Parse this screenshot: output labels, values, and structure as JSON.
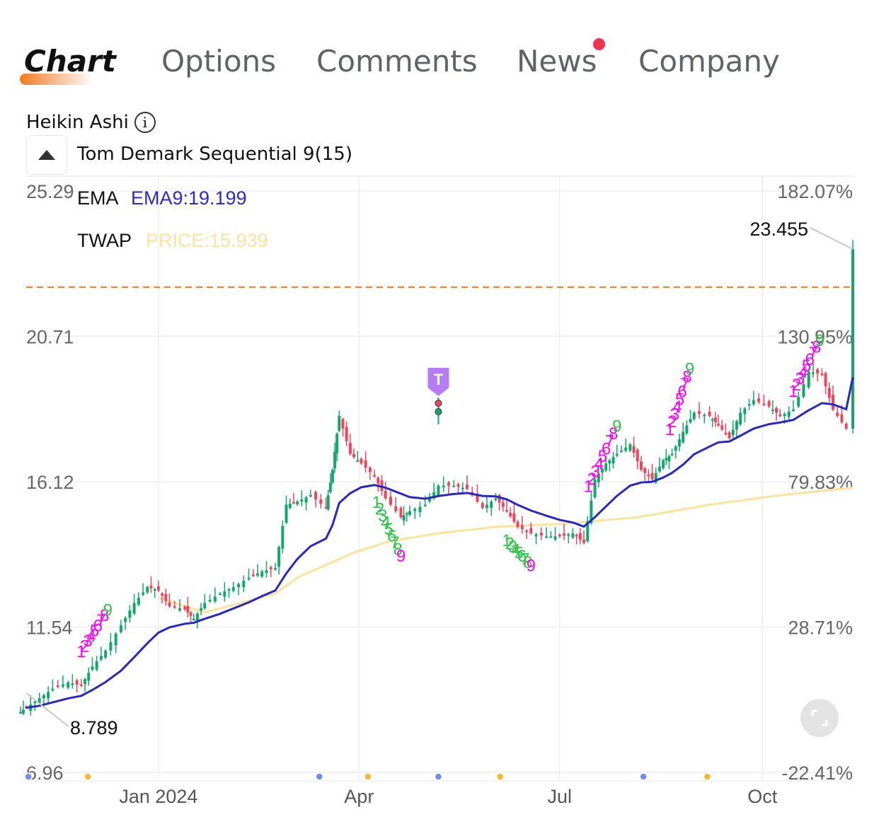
{
  "tabs": [
    {
      "label": "Chart",
      "active": true
    },
    {
      "label": "Options",
      "active": false
    },
    {
      "label": "Comments",
      "active": false
    },
    {
      "label": "News",
      "active": false,
      "badge_dot": true
    },
    {
      "label": "Company",
      "active": false
    }
  ],
  "chart_type_label": "Heikin Ashi",
  "info_icon": "info-icon",
  "indicator_title": "Tom Demark Sequential 9(15)",
  "collapse_icon": "triangle-up-icon",
  "legend": {
    "ema": {
      "name": "EMA",
      "value": "EMA9:19.199",
      "color": "#2a2ad0"
    },
    "twap": {
      "name": "TWAP",
      "value": "PRICE:15.939",
      "color": "#fde29a"
    }
  },
  "colors": {
    "up": "#12a86b",
    "down": "#f0445a",
    "ema": "#2727c4",
    "twap": "#fde29a",
    "dashed_line": "#f57c1f",
    "td_up": "#ff00ff",
    "td_down": "#2ec44a",
    "marker": "#b57cf5"
  },
  "chart_data": {
    "type": "candlestick",
    "style": "Heikin Ashi",
    "x_range": [
      "2023-11-02",
      "2024-11-11"
    ],
    "ylim": [
      6.96,
      25.29
    ],
    "grid": true,
    "y_ticks_left": [
      "25.29",
      "20.71",
      "16.12",
      "11.54",
      "6.96"
    ],
    "y_ticks_right": [
      "182.07%",
      "130.95%",
      "79.83%",
      "28.71%",
      "-22.41%"
    ],
    "x_ticks": [
      {
        "label": "Jan 2024",
        "date": "2024-01-01"
      },
      {
        "label": "Apr",
        "date": "2024-04-01"
      },
      {
        "label": "Jul",
        "date": "2024-07-01"
      },
      {
        "label": "Oct",
        "date": "2024-10-01"
      }
    ],
    "high_label": {
      "text": "23.455",
      "date": "2024-11-11",
      "price": 23.455
    },
    "low_label": {
      "text": "8.789",
      "date": "2023-11-02",
      "price": 8.789
    },
    "dashed_price_line": 22.26,
    "closes": [
      [
        "2023-11-02",
        9.0
      ],
      [
        "2023-11-08",
        9.3
      ],
      [
        "2023-11-14",
        9.6
      ],
      [
        "2023-11-21",
        9.8
      ],
      [
        "2023-11-27",
        9.7
      ],
      [
        "2023-12-02",
        10.3
      ],
      [
        "2023-12-08",
        10.8
      ],
      [
        "2023-12-15",
        11.6
      ],
      [
        "2023-12-21",
        12.3
      ],
      [
        "2023-12-27",
        12.8
      ],
      [
        "2024-01-01",
        12.7
      ],
      [
        "2024-01-06",
        12.2
      ],
      [
        "2024-01-13",
        12.1
      ],
      [
        "2024-01-17",
        11.8
      ],
      [
        "2024-01-22",
        12.3
      ],
      [
        "2024-01-29",
        12.6
      ],
      [
        "2024-02-04",
        12.8
      ],
      [
        "2024-02-11",
        13.1
      ],
      [
        "2024-02-17",
        13.3
      ],
      [
        "2024-02-23",
        13.4
      ],
      [
        "2024-02-28",
        15.4
      ],
      [
        "2024-03-04",
        15.5
      ],
      [
        "2024-03-10",
        15.7
      ],
      [
        "2024-03-17",
        15.3
      ],
      [
        "2024-03-20",
        16.5
      ],
      [
        "2024-03-23",
        18.2
      ],
      [
        "2024-03-28",
        17.0
      ],
      [
        "2024-04-02",
        16.7
      ],
      [
        "2024-04-08",
        16.3
      ],
      [
        "2024-04-13",
        15.6
      ],
      [
        "2024-04-20",
        15.0
      ],
      [
        "2024-04-24",
        15.2
      ],
      [
        "2024-05-01",
        15.4
      ],
      [
        "2024-05-07",
        16.0
      ],
      [
        "2024-05-14",
        16.0
      ],
      [
        "2024-05-20",
        15.9
      ],
      [
        "2024-05-27",
        15.3
      ],
      [
        "2024-06-02",
        15.6
      ],
      [
        "2024-06-07",
        15.2
      ],
      [
        "2024-06-12",
        14.7
      ],
      [
        "2024-06-18",
        14.5
      ],
      [
        "2024-06-25",
        14.4
      ],
      [
        "2024-07-01",
        14.4
      ],
      [
        "2024-07-07",
        14.5
      ],
      [
        "2024-07-12",
        14.2
      ],
      [
        "2024-07-17",
        16.2
      ],
      [
        "2024-07-22",
        16.7
      ],
      [
        "2024-07-27",
        17.0
      ],
      [
        "2024-08-02",
        17.3
      ],
      [
        "2024-08-07",
        16.5
      ],
      [
        "2024-08-12",
        16.2
      ],
      [
        "2024-08-17",
        16.8
      ],
      [
        "2024-08-21",
        17.0
      ],
      [
        "2024-08-26",
        17.7
      ],
      [
        "2024-08-31",
        18.3
      ],
      [
        "2024-09-07",
        18.2
      ],
      [
        "2024-09-11",
        17.9
      ],
      [
        "2024-09-16",
        17.5
      ],
      [
        "2024-09-21",
        18.3
      ],
      [
        "2024-09-27",
        18.7
      ],
      [
        "2024-10-04",
        18.5
      ],
      [
        "2024-10-09",
        18.2
      ],
      [
        "2024-10-15",
        18.4
      ],
      [
        "2024-10-22",
        19.6
      ],
      [
        "2024-10-28",
        19.5
      ],
      [
        "2024-11-02",
        18.4
      ],
      [
        "2024-11-08",
        17.8
      ],
      [
        "2024-11-11",
        23.455
      ]
    ],
    "twap": [
      [
        "2024-01-01",
        12.47
      ],
      [
        "2024-01-22",
        12.0
      ],
      [
        "2024-02-23",
        12.6
      ],
      [
        "2024-03-04",
        13.1
      ],
      [
        "2024-03-30",
        13.9
      ],
      [
        "2024-04-15",
        14.25
      ],
      [
        "2024-05-07",
        14.5
      ],
      [
        "2024-06-02",
        14.7
      ],
      [
        "2024-07-03",
        14.8
      ],
      [
        "2024-08-05",
        15.0
      ],
      [
        "2024-09-07",
        15.4
      ],
      [
        "2024-10-09",
        15.7
      ],
      [
        "2024-11-11",
        15.939
      ]
    ],
    "ema_period": 9,
    "td_sequences": [
      {
        "from": [
          "2023-11-27",
          10.6
        ],
        "to": [
          "2023-12-09",
          11.9
        ],
        "count_color": "#ff00ff",
        "nine_color": "#2ec44a"
      },
      {
        "from": [
          "2024-04-09",
          15.3
        ],
        "to": [
          "2024-04-20",
          13.6
        ],
        "count_color": "#2ec44a",
        "nine_color": "#ff00ff"
      },
      {
        "from": [
          "2024-06-07",
          14.1
        ],
        "to": [
          "2024-06-18",
          13.3
        ],
        "count_color": "#2ec44a",
        "nine_color": "#ff00ff"
      },
      {
        "from": [
          "2024-07-14",
          15.8
        ],
        "to": [
          "2024-07-27",
          17.7
        ],
        "count_color": "#ff00ff",
        "nine_color": "#2ec44a"
      },
      {
        "from": [
          "2024-08-20",
          17.6
        ],
        "to": [
          "2024-08-29",
          19.5
        ],
        "count_color": "#ff00ff",
        "nine_color": "#2ec44a"
      },
      {
        "from": [
          "2024-10-15",
          18.8
        ],
        "to": [
          "2024-10-27",
          20.4
        ],
        "count_color": "#ff00ff",
        "nine_color": "#2ec44a"
      }
    ],
    "event_marker": {
      "label": "T",
      "date": "2024-05-07",
      "price": 18.6
    },
    "event_dots": [
      {
        "date": "2023-11-03",
        "color": "#6b8ff0"
      },
      {
        "date": "2023-11-30",
        "color": "#f5b82e"
      },
      {
        "date": "2024-03-14",
        "color": "#6b8ff0"
      },
      {
        "date": "2024-04-05",
        "color": "#f5b82e"
      },
      {
        "date": "2024-05-07",
        "color": "#6b8ff0"
      },
      {
        "date": "2024-06-04",
        "color": "#f5b82e"
      },
      {
        "date": "2024-08-08",
        "color": "#6b8ff0"
      },
      {
        "date": "2024-09-06",
        "color": "#f5b82e"
      }
    ]
  },
  "fullscreen_icon": "fullscreen-icon"
}
